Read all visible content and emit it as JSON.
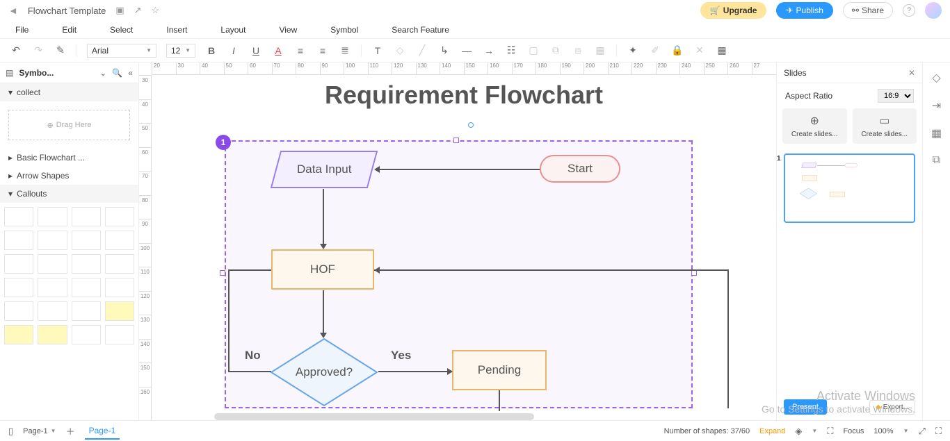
{
  "topbar": {
    "title": "Flowchart Template",
    "upgrade": "Upgrade",
    "publish": "Publish",
    "share": "Share"
  },
  "menu": {
    "file": "File",
    "edit": "Edit",
    "select": "Select",
    "insert": "Insert",
    "layout": "Layout",
    "view": "View",
    "symbol": "Symbol",
    "search": "Search Feature"
  },
  "toolbar": {
    "font": "Arial",
    "size": "12"
  },
  "leftpanel": {
    "title": "Symbo...",
    "collect": "collect",
    "drag_here": "Drag Here",
    "basic_flowchart": "Basic Flowchart ...",
    "arrow_shapes": "Arrow Shapes",
    "callouts": "Callouts"
  },
  "ruler_h": [
    "20",
    "30",
    "40",
    "50",
    "60",
    "70",
    "80",
    "90",
    "100",
    "110",
    "120",
    "130",
    "140",
    "150",
    "160",
    "170",
    "180",
    "190",
    "200",
    "210",
    "220",
    "230",
    "240",
    "250",
    "260",
    "27"
  ],
  "ruler_v": [
    "30",
    "40",
    "50",
    "60",
    "70",
    "80",
    "90",
    "100",
    "110",
    "120",
    "130",
    "140",
    "150",
    "160"
  ],
  "canvas": {
    "title": "Requirement Flowchart",
    "selection_badge": "1",
    "nodes": {
      "start": "Start",
      "data_input": "Data Input",
      "hof": "HOF",
      "approved": "Approved?",
      "pending": "Pending"
    },
    "labels": {
      "no": "No",
      "yes": "Yes"
    }
  },
  "rightpanel": {
    "title": "Slides",
    "aspect_label": "Aspect Ratio",
    "aspect_value": "16:9",
    "create1": "Create slides...",
    "create2": "Create slides...",
    "thumb_num": "1",
    "present": "Present",
    "export": "Export..."
  },
  "bottombar": {
    "page_dd": "Page-1",
    "page_tab": "Page-1",
    "shapes_label": "Number of shapes: 37/60",
    "expand": "Expand",
    "focus": "Focus",
    "zoom": "100%"
  },
  "watermark": {
    "line1": "Activate Windows",
    "line2": "Go to Settings to activate Windows."
  }
}
